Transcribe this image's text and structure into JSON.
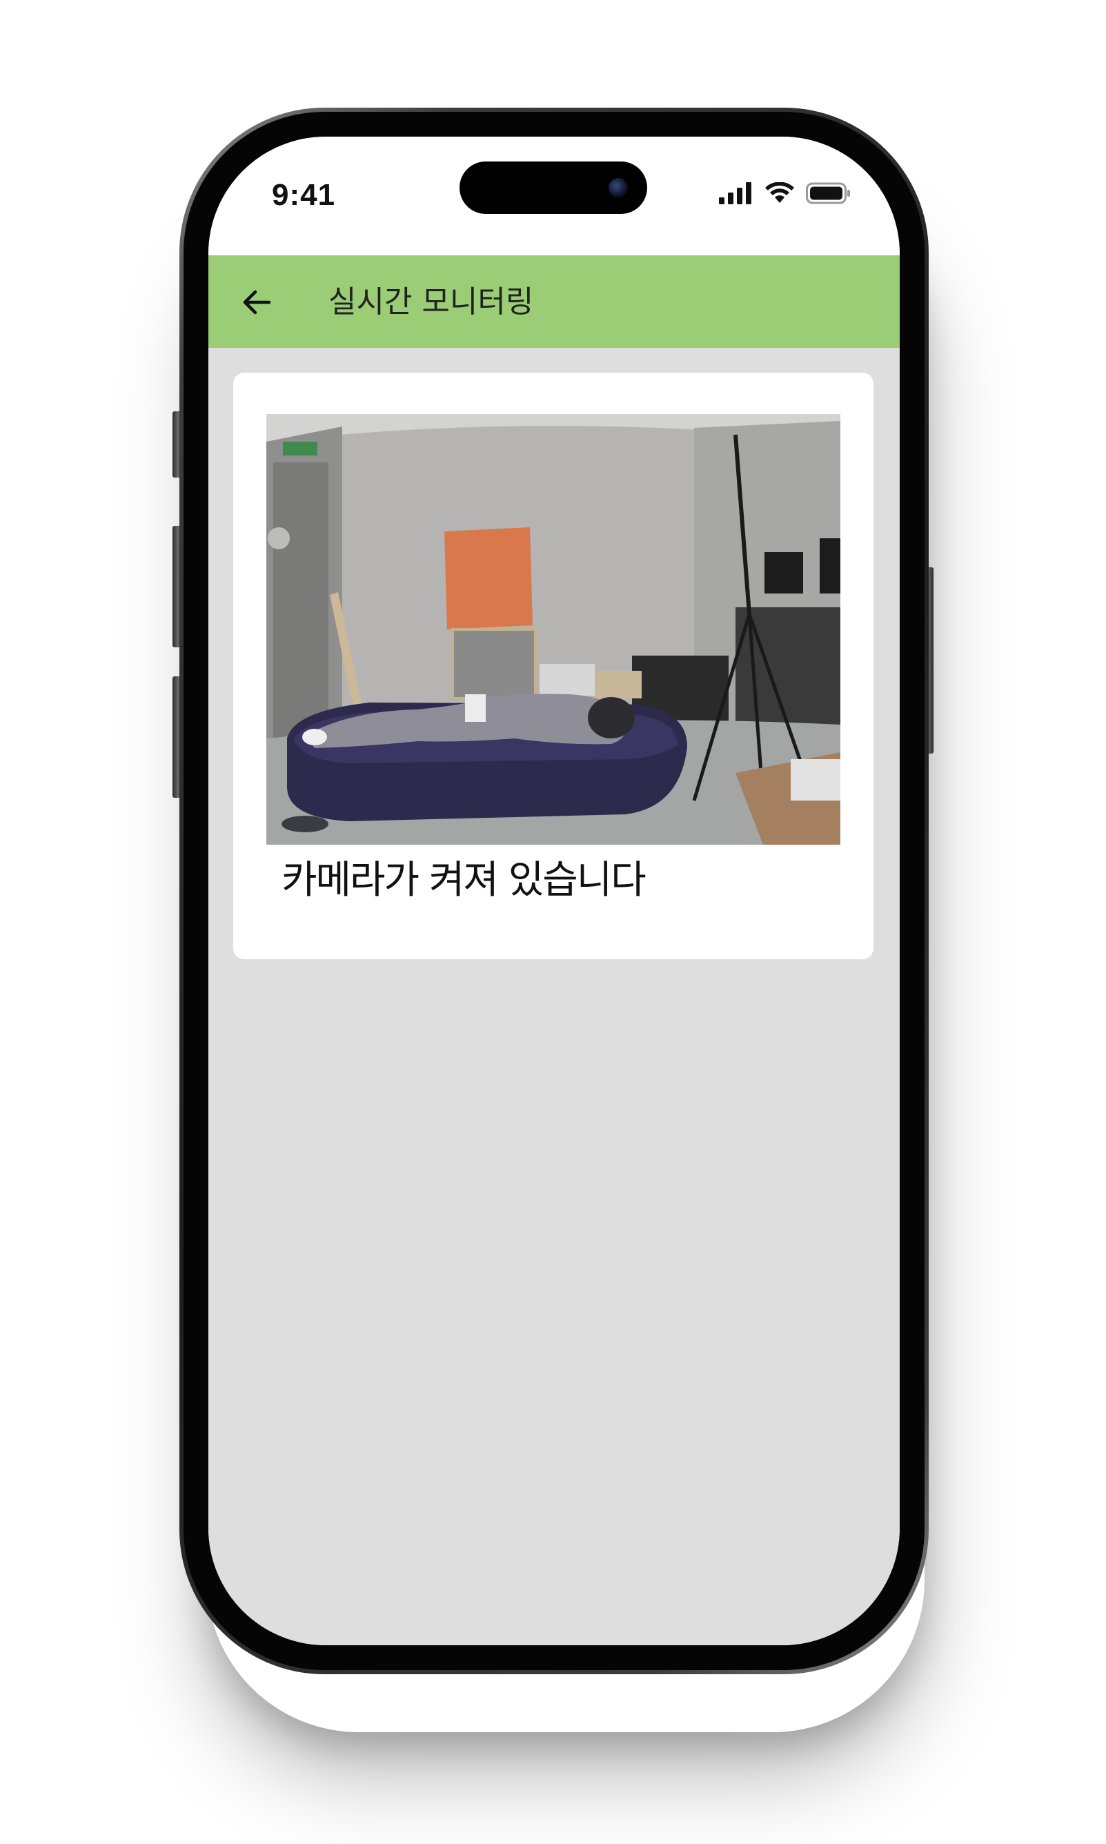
{
  "status_bar": {
    "time": "9:41",
    "icons": [
      "cellular-signal-icon",
      "wifi-icon",
      "battery-icon"
    ]
  },
  "header": {
    "back_icon": "arrow-left-icon",
    "title": "실시간 모니터링",
    "background_color": "#9bcc76"
  },
  "camera_card": {
    "feed_description_icon": "live-camera-feed",
    "caption": "카메라가 켜져 있습니다"
  },
  "colors": {
    "screen_background": "#dedede",
    "card_background": "#ffffff",
    "header_accent": "#9bcc76"
  }
}
